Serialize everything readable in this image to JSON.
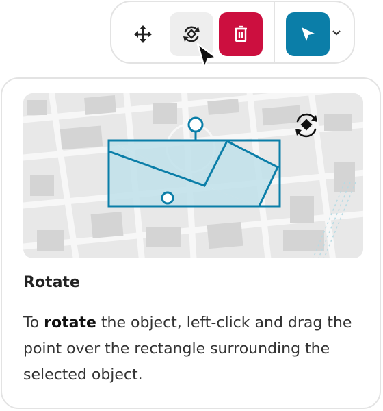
{
  "toolbar": {
    "buttons": [
      {
        "name": "move",
        "icon": "move-arrows-icon"
      },
      {
        "name": "rotate",
        "icon": "rotate-icon",
        "state": "hovered"
      },
      {
        "name": "delete",
        "icon": "trash-icon",
        "color": "#cc0f3f"
      },
      {
        "name": "select",
        "icon": "pointer-arrow-icon",
        "color": "#0b7ea8"
      }
    ],
    "dropdown_icon": "chevron-down-icon"
  },
  "card": {
    "title": "Rotate",
    "body_prefix": "To ",
    "body_bold": "rotate",
    "body_suffix": " the object, left-click and drag the point over the rectangle surrounding the selected object.",
    "illustration": {
      "map_icon": "rotate-hint-icon",
      "accent_color": "#0b7ea8",
      "fill_color": "#bfe0ea"
    }
  }
}
